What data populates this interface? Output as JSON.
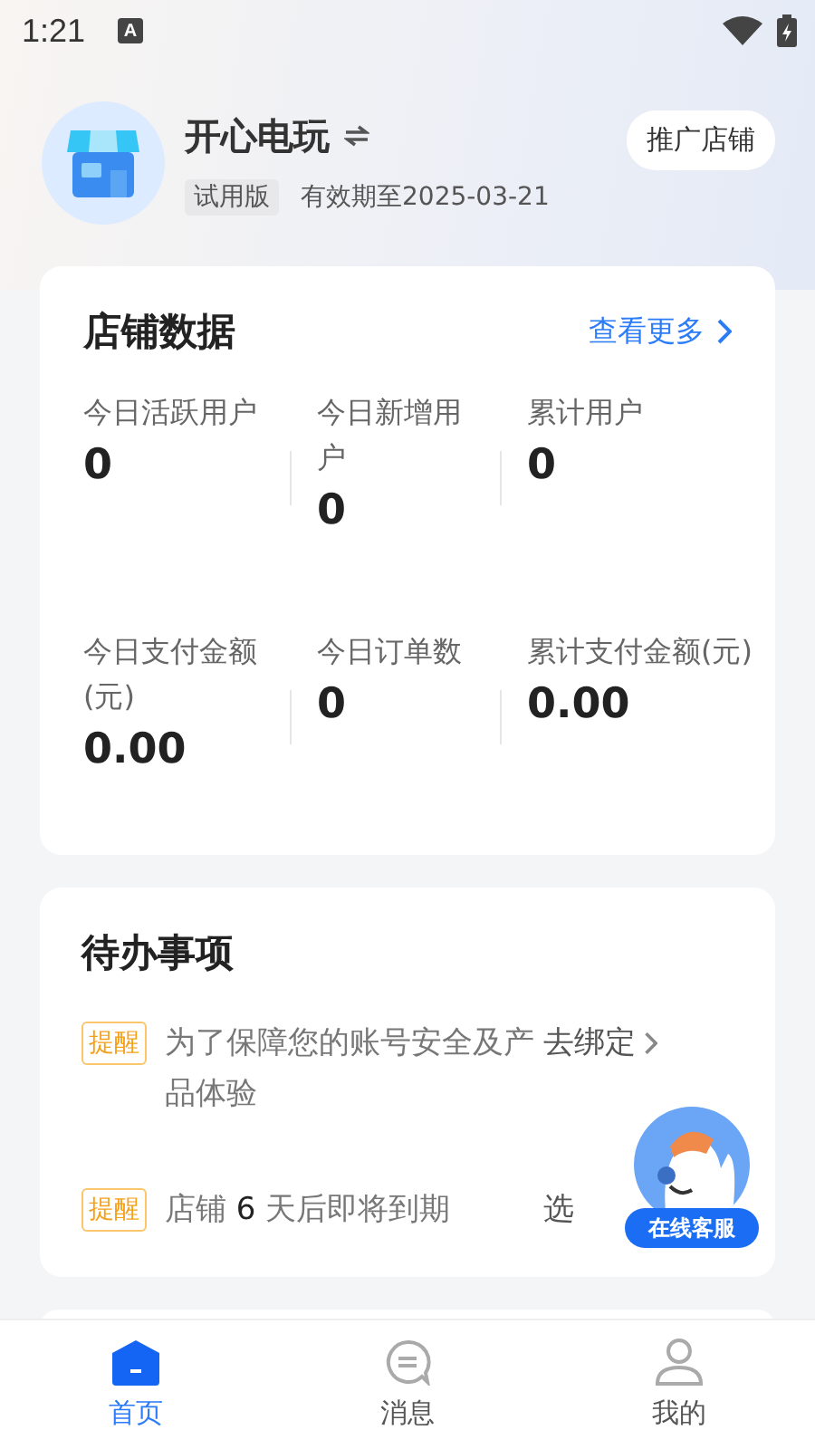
{
  "status_bar": {
    "time": "1:21",
    "app_icon": "A"
  },
  "store": {
    "name": "开心电玩",
    "badge": "试用版",
    "expiry": "有效期至2025-03-21",
    "promote_button": "推广店铺"
  },
  "store_data": {
    "title": "店铺数据",
    "more_link": "查看更多",
    "stats": [
      {
        "label": "今日活跃用户",
        "value": "0"
      },
      {
        "label": "今日新增用户",
        "value": "0"
      },
      {
        "label": "累计用户",
        "value": "0"
      },
      {
        "label": "今日支付金额(元)",
        "value": "0.00"
      },
      {
        "label": "今日订单数",
        "value": "0"
      },
      {
        "label": "累计支付金额(元)",
        "value": "0.00"
      }
    ]
  },
  "todos": {
    "title": "待办事项",
    "items": [
      {
        "tag": "提醒",
        "text": "为了保障您的账号安全及产品体验",
        "action": "去绑定"
      },
      {
        "tag": "提醒",
        "text": "店铺 **6** 天后即将到期",
        "action": "选"
      }
    ]
  },
  "support_widget": {
    "label": "在线客服"
  },
  "tab_bar": [
    {
      "label": "首页",
      "selected": true,
      "kind": "home"
    },
    {
      "label": "消息",
      "selected": false,
      "kind": "message"
    },
    {
      "label": "我的",
      "selected": false,
      "kind": "profile"
    }
  ]
}
